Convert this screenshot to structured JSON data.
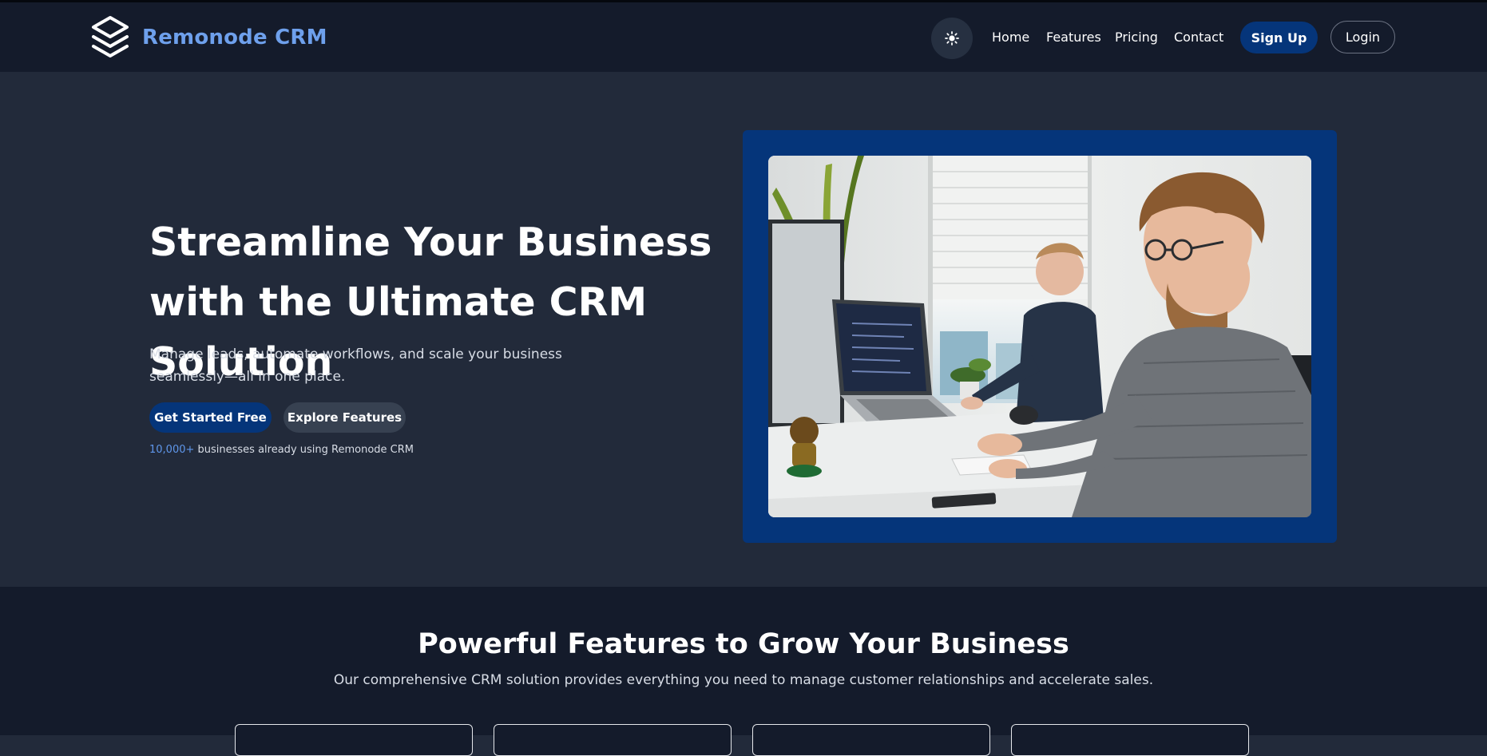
{
  "brand": {
    "name": "Remonode CRM",
    "logo_icon": "stacked-layers-icon"
  },
  "nav": {
    "theme_toggle_icon": "sun-icon",
    "links": [
      "Home",
      "Features",
      "Pricing",
      "Contact"
    ],
    "signup_label": "Sign Up",
    "login_label": "Login"
  },
  "hero": {
    "title": "Streamline Your Business with the Ultimate CRM Solution",
    "subtitle": "Manage leads, automate workflows, and scale your business seamlessly—all in one place.",
    "primary_cta": "Get Started Free",
    "secondary_cta": "Explore Features",
    "social_proof_count": "10,000+",
    "social_proof_text": " businesses already using Remonode CRM"
  },
  "features": {
    "title": "Powerful Features to Grow Your Business",
    "subtitle": "Our comprehensive CRM solution provides everything you need to manage customer relationships and accelerate sales."
  },
  "colors": {
    "page_bg": "#222a3a",
    "navbar_bg": "#141b2b",
    "brand_accent": "#6ea0ec",
    "primary_button": "#05357a",
    "secondary_button": "#374151",
    "highlight_text": "#5f97ec"
  }
}
